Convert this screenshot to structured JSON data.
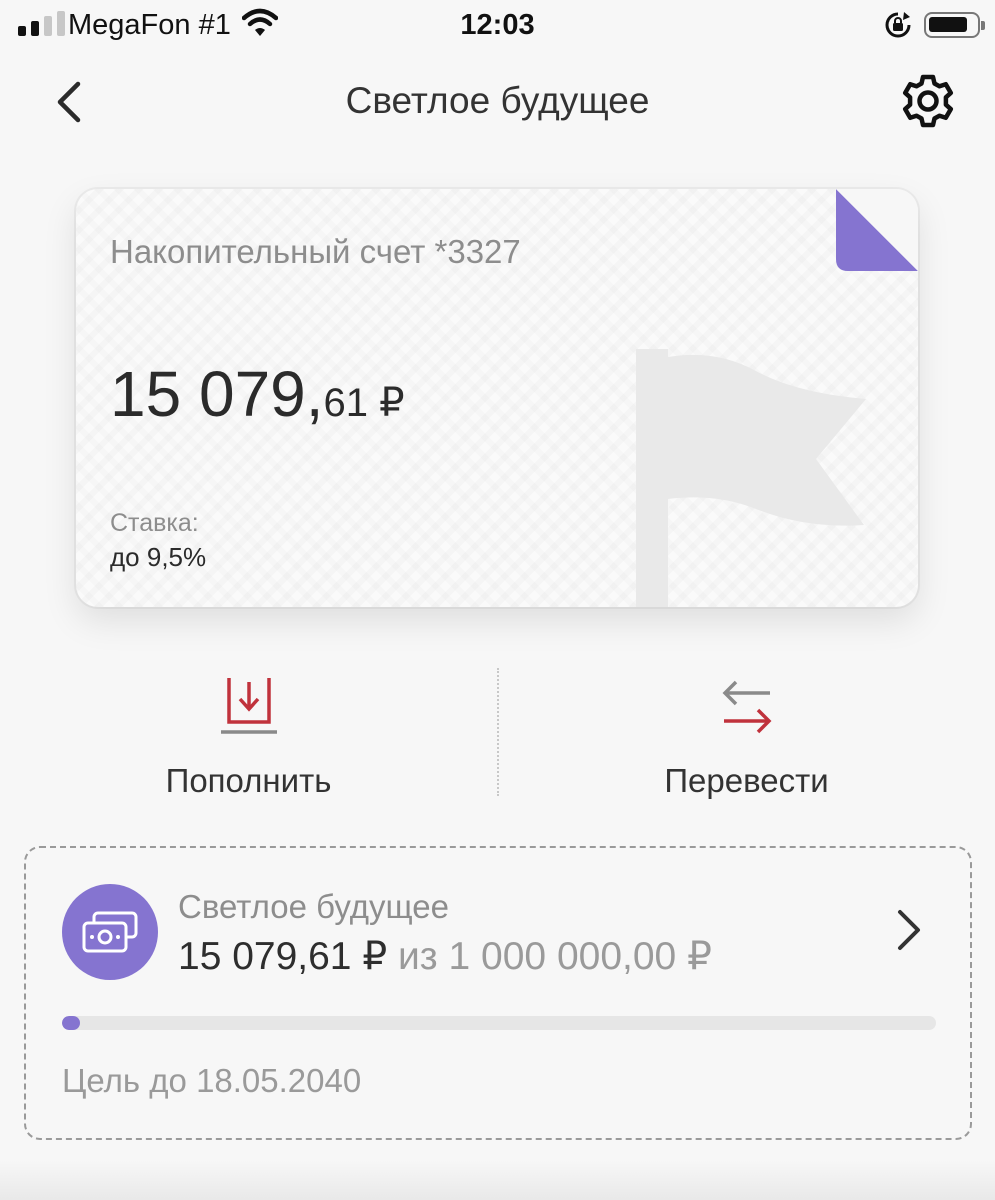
{
  "status_bar": {
    "carrier": "MegaFon #1",
    "time": "12:03",
    "signal_bars": 4,
    "signal_active": 2,
    "battery_level": 0.7
  },
  "nav": {
    "title": "Светлое будущее",
    "back_icon": "chevron-left-icon",
    "settings_icon": "gear-icon"
  },
  "card": {
    "account_label": "Накопительный счет *3327",
    "balance_int": "15 079,",
    "balance_frac": "61 ₽",
    "rate_label": "Ставка:",
    "rate_value": "до 9,5%",
    "corner_color": "#8574d0",
    "art_icon": "flag-icon"
  },
  "actions": {
    "deposit_label": "Пополнить",
    "deposit_icon": "deposit-icon",
    "transfer_label": "Перевести",
    "transfer_icon": "transfer-arrows-icon",
    "accent": "#c0323c"
  },
  "goal": {
    "name": "Светлое будущее",
    "current": "15 079,61 ₽",
    "separator": "из",
    "target": "1 000 000,00 ₽",
    "progress_fraction": 0.0151,
    "deadline": "Цель до 18.05.2040",
    "icon": "money-icon",
    "accent": "#8574d0"
  }
}
